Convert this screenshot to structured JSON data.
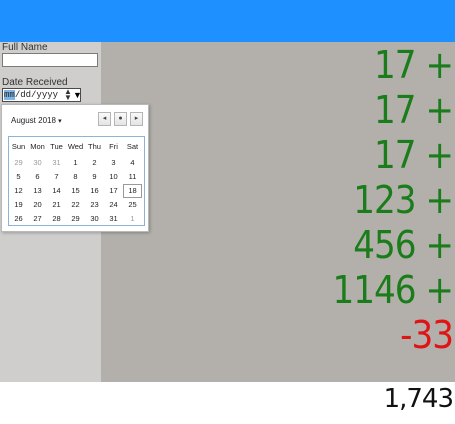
{
  "form": {
    "full_name_label": "Full Name",
    "full_name_value": "",
    "date_label": "Date Received",
    "date_placeholder": "mm/dd/yyyy",
    "date_seg_mm": "mm",
    "date_seg_rest": "/dd/yyyy",
    "spin_up": "▲",
    "spin_down": "▼",
    "dropdown_glyph": "▼"
  },
  "calendar": {
    "month_label": "August 2018",
    "month_arrow": "▾",
    "prev_glyph": "◂",
    "today_glyph": "●",
    "next_glyph": "▸",
    "weekdays": [
      "Sun",
      "Mon",
      "Tue",
      "Wed",
      "Thu",
      "Fri",
      "Sat"
    ],
    "weeks": [
      [
        "29",
        "30",
        "31",
        "1",
        "2",
        "3",
        "4"
      ],
      [
        "5",
        "6",
        "7",
        "8",
        "9",
        "10",
        "11"
      ],
      [
        "12",
        "13",
        "14",
        "15",
        "16",
        "17",
        "18"
      ],
      [
        "19",
        "20",
        "21",
        "22",
        "23",
        "24",
        "25"
      ],
      [
        "26",
        "27",
        "28",
        "29",
        "30",
        "31",
        "1"
      ]
    ],
    "out_of_month": [
      [
        0,
        0
      ],
      [
        0,
        1
      ],
      [
        0,
        2
      ],
      [
        4,
        6
      ]
    ],
    "selected": [
      2,
      6
    ]
  },
  "numbers": [
    {
      "text": "17 +",
      "color": "#1a7c1a"
    },
    {
      "text": "17 +",
      "color": "#1a7c1a"
    },
    {
      "text": "17 +",
      "color": "#1a7c1a"
    },
    {
      "text": "123 +",
      "color": "#1a7c1a"
    },
    {
      "text": "456 +",
      "color": "#1a7c1a"
    },
    {
      "text": "1146 +",
      "color": "#1a7c1a"
    },
    {
      "text": "-33",
      "color": "#e01414"
    }
  ],
  "total": "1,743",
  "colors": {
    "topbar": "#1e90ff",
    "positive": "#1a7c1a",
    "negative": "#e01414"
  }
}
